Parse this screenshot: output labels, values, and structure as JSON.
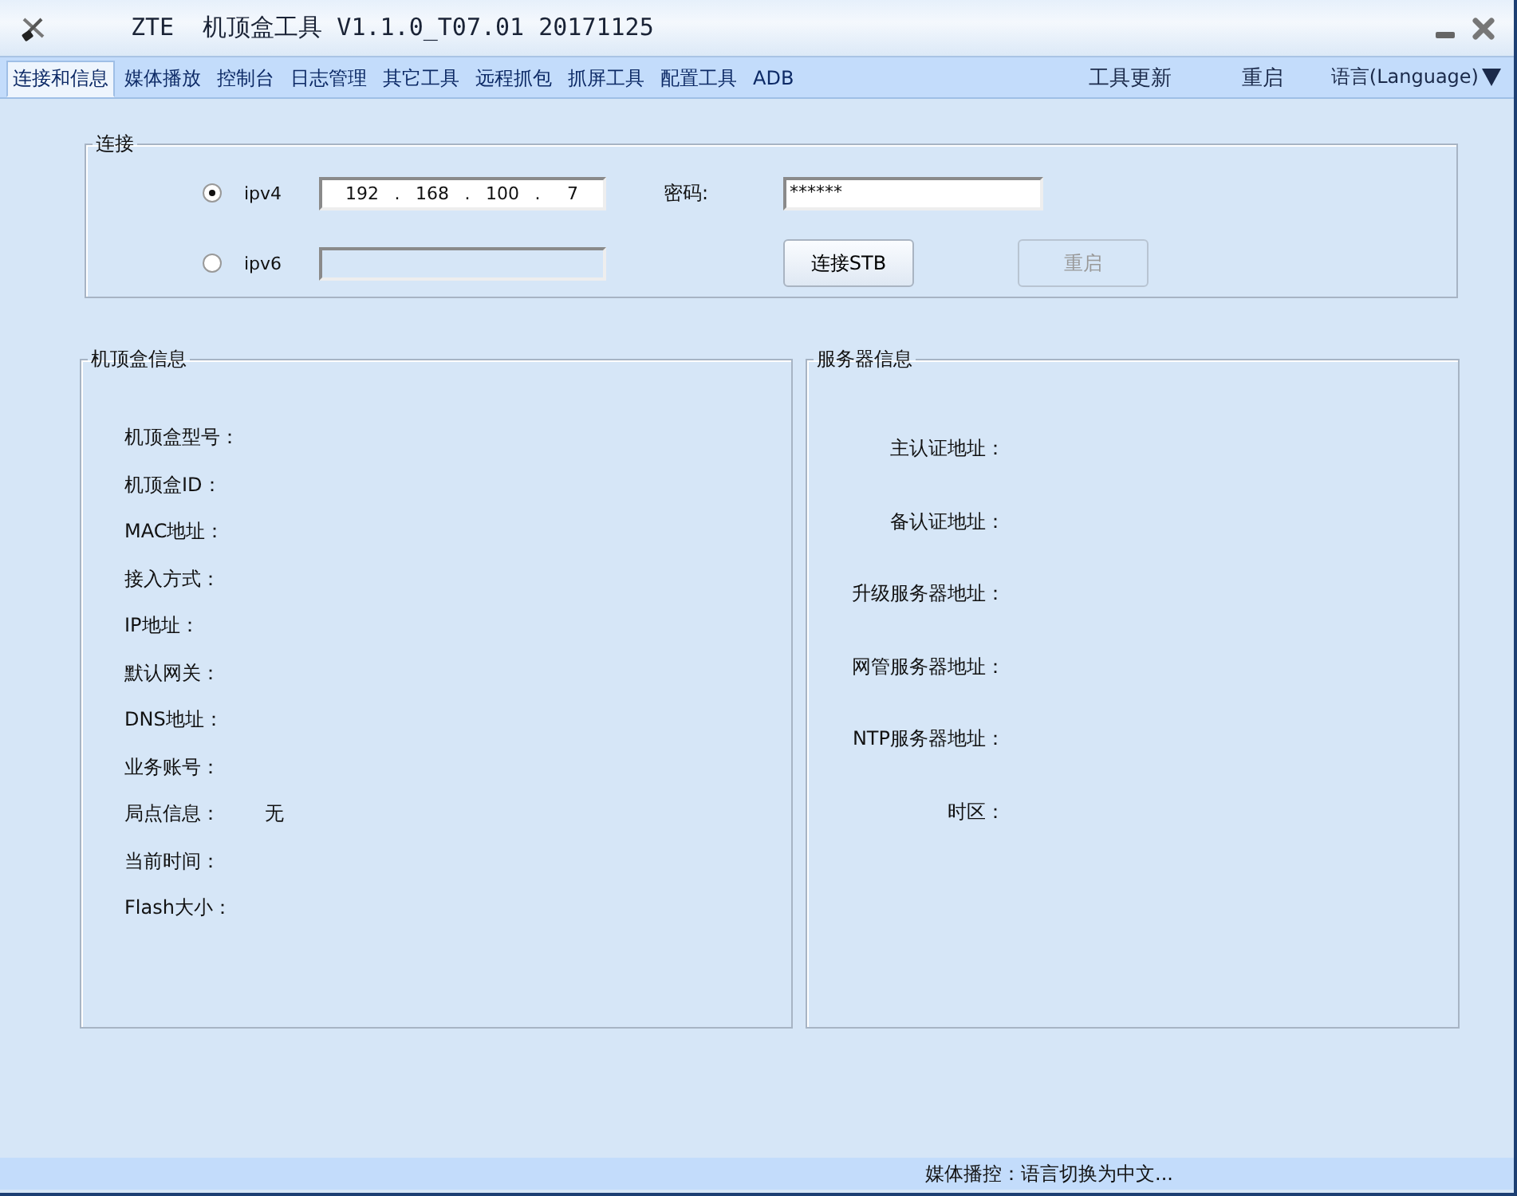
{
  "window": {
    "title": "ZTE  机顶盒工具 V1.1.0_T07.01 20171125"
  },
  "tabs": [
    {
      "label": "连接和信息",
      "selected": true
    },
    {
      "label": "媒体播放",
      "selected": false
    },
    {
      "label": "控制台",
      "selected": false
    },
    {
      "label": "日志管理",
      "selected": false
    },
    {
      "label": "其它工具",
      "selected": false
    },
    {
      "label": "远程抓包",
      "selected": false
    },
    {
      "label": "抓屏工具",
      "selected": false
    },
    {
      "label": "配置工具",
      "selected": false
    },
    {
      "label": "ADB",
      "selected": false
    }
  ],
  "toolbar_links": [
    "工具更新",
    "重启"
  ],
  "language_menu": {
    "label": "语言(Language)"
  },
  "connection": {
    "title": "连接",
    "modes": [
      {
        "label": "ipv4",
        "selected": true,
        "kind": "octets"
      },
      {
        "label": "ipv6",
        "selected": false,
        "kind": "blank"
      }
    ],
    "ipv4_octets": [
      "192",
      "168",
      "100",
      "7"
    ],
    "separator": ".",
    "password_label": "密码:",
    "password_value": "******",
    "buttons": [
      {
        "label": "连接STB",
        "disabled": false
      },
      {
        "label": "重启",
        "disabled": true
      }
    ]
  },
  "stb_info": {
    "title": "机顶盒信息",
    "rows": [
      {
        "label": "机顶盒型号："
      },
      {
        "label": "机顶盒ID："
      },
      {
        "label": "MAC地址："
      },
      {
        "label": "接入方式："
      },
      {
        "label": "IP地址："
      },
      {
        "label": "默认网关："
      },
      {
        "label": "DNS地址："
      },
      {
        "label": "业务账号："
      },
      {
        "label": "局点信息：",
        "value": "无"
      },
      {
        "label": "当前时间："
      },
      {
        "label": "Flash大小："
      }
    ]
  },
  "server_info": {
    "title": "服务器信息",
    "rows": [
      {
        "label": "主认证地址："
      },
      {
        "label": "备认证地址："
      },
      {
        "label": "升级服务器地址："
      },
      {
        "label": "网管服务器地址："
      },
      {
        "label": "NTP服务器地址："
      },
      {
        "label": "时区："
      }
    ]
  },
  "status_bar": {
    "text": "媒体播控：语言切换为中文..."
  }
}
